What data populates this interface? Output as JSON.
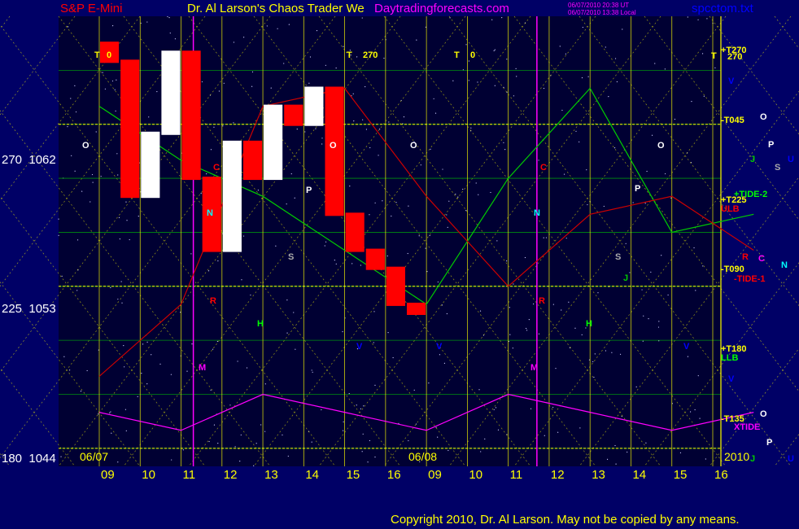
{
  "header": {
    "instrument": "S&P E-Mini",
    "title": "Dr. Al Larson's Chaos Trader We",
    "site": "Daytradingforecasts.com",
    "stamp_line1": "06/07/2010 20:38 UT",
    "stamp_line2": "06/07/2010 13:38 Local",
    "file": "spcctom.txt"
  },
  "colors": {
    "background": "#000066",
    "plot_bg": "#000033",
    "price_up": "#ffffff",
    "price_down": "#ff0000",
    "grid_yellow": "#ffff00",
    "grid_green": "#00cc00",
    "red_curve": "#cc0000",
    "green_curve": "#00cc00",
    "xtide": "#ff00ff",
    "time_marker_magenta": "#ff00ff"
  },
  "y_axis_labels": [
    {
      "angle": "270",
      "price": "1062"
    },
    {
      "angle": "225",
      "price": "1053"
    },
    {
      "angle": "180",
      "price": "1044"
    }
  ],
  "right_labels": [
    {
      "text": "+T270",
      "color": "#ffff00"
    },
    {
      "text": "T",
      "color": "#ffff00"
    },
    {
      "text": "270",
      "color": "#ffff00"
    },
    {
      "text": "-T045",
      "color": "#ffff00"
    },
    {
      "text": "+T225",
      "color": "#ffff00"
    },
    {
      "text": "+TIDE-2",
      "color": "#00ff00"
    },
    {
      "text": "ULB",
      "color": "#ff0000"
    },
    {
      "text": "-T090",
      "color": "#ffff00"
    },
    {
      "text": "-TIDE-1",
      "color": "#ff0000"
    },
    {
      "text": "+T180",
      "color": "#ffff00"
    },
    {
      "text": "LLB",
      "color": "#00ff00"
    },
    {
      "text": "-T135",
      "color": "#ffff00"
    },
    {
      "text": "XTIDE",
      "color": "#ff00ff"
    }
  ],
  "legend_glyphs": [
    {
      "text": "O",
      "color": "#ffffff"
    },
    {
      "text": "J",
      "color": "#00cc00"
    },
    {
      "text": "P",
      "color": "#ffffff"
    },
    {
      "text": "S",
      "color": "#aaaaaa"
    },
    {
      "text": "U",
      "color": "#0000ff"
    },
    {
      "text": "R",
      "color": "#ff0000"
    },
    {
      "text": "C",
      "color": "#ff00ff"
    },
    {
      "text": "N",
      "color": "#00ffff"
    },
    {
      "text": "O",
      "color": "#ffffff"
    },
    {
      "text": "P",
      "color": "#ffffff"
    },
    {
      "text": "J",
      "color": "#00cc00"
    },
    {
      "text": "U",
      "color": "#0000ff"
    }
  ],
  "chart_glyphs": [
    {
      "text": "T",
      "color": "#ffff00"
    },
    {
      "text": "0",
      "color": "#ffff00"
    },
    {
      "text": "T",
      "color": "#ffff00"
    },
    {
      "text": "270",
      "color": "#ffff00"
    },
    {
      "text": "T",
      "color": "#ffff00"
    },
    {
      "text": "0",
      "color": "#ffff00"
    },
    {
      "text": "O",
      "color": "#ffffff"
    },
    {
      "text": "O",
      "color": "#ffffff"
    },
    {
      "text": "O",
      "color": "#ffffff"
    },
    {
      "text": "O",
      "color": "#ffffff"
    },
    {
      "text": "C",
      "color": "#ff0000"
    },
    {
      "text": "C",
      "color": "#ff0000"
    },
    {
      "text": "N",
      "color": "#00ffff"
    },
    {
      "text": "N",
      "color": "#00ffff"
    },
    {
      "text": "P",
      "color": "#ffffff"
    },
    {
      "text": "P",
      "color": "#ffffff"
    },
    {
      "text": "S",
      "color": "#aaaaaa"
    },
    {
      "text": "S",
      "color": "#aaaaaa"
    },
    {
      "text": "R",
      "color": "#ff0000"
    },
    {
      "text": "R",
      "color": "#ff0000"
    },
    {
      "text": "H",
      "color": "#00ff00"
    },
    {
      "text": "H",
      "color": "#00ff00"
    },
    {
      "text": "M",
      "color": "#ff00ff"
    },
    {
      "text": "M",
      "color": "#ff00ff"
    },
    {
      "text": "V",
      "color": "#0000ff"
    },
    {
      "text": "V",
      "color": "#0000ff"
    },
    {
      "text": "V",
      "color": "#0000ff"
    },
    {
      "text": "V",
      "color": "#0000ff"
    },
    {
      "text": "V",
      "color": "#0000ff"
    },
    {
      "text": "J",
      "color": "#00cc00"
    }
  ],
  "date_labels": [
    "06/07",
    "06/08",
    "2010"
  ],
  "copyright": "Copyright 2010, Dr. Al Larson. May not be copied by any means.",
  "chart_data": {
    "type": "line",
    "title": "S&P E-Mini",
    "x_tick_labels": [
      "09",
      "10",
      "11",
      "12",
      "13",
      "14",
      "15",
      "16",
      "09",
      "10",
      "11",
      "12",
      "13",
      "14",
      "15",
      "16"
    ],
    "y_axis": {
      "labels": [
        "1062",
        "1053",
        "1044"
      ],
      "angle_labels": [
        "270",
        "225",
        "180"
      ],
      "ylim": [
        1043,
        1068
      ]
    },
    "grid": true,
    "series": [
      {
        "name": "price",
        "sessions": [
          "06/07"
        ],
        "x": [
          0,
          0.5,
          1,
          1.5,
          2,
          2.5,
          3,
          3.5,
          4,
          4.5,
          5,
          5.5,
          6,
          6.5,
          7,
          7.5,
          8
        ],
        "y": [
          1066.5,
          1065.5,
          1058,
          1061.5,
          1066,
          1059,
          1055,
          1061,
          1059,
          1063,
          1062,
          1064,
          1057,
          1055,
          1054,
          1052,
          1051.5
        ]
      },
      {
        "name": "+TIDE-2",
        "x": [
          0,
          2,
          4,
          6,
          8,
          10,
          12,
          14,
          16
        ],
        "y": [
          1063,
          1060,
          1058,
          1055,
          1052,
          1059,
          1064,
          1056,
          1057
        ]
      },
      {
        "name": "-TIDE-1",
        "x": [
          0,
          2,
          4,
          6,
          8,
          10,
          12,
          14,
          16
        ],
        "y": [
          1048,
          1052,
          1063,
          1064,
          1058,
          1053,
          1057,
          1058,
          1055
        ]
      },
      {
        "name": "XTIDE",
        "x": [
          0,
          2,
          4,
          6,
          8,
          10,
          12,
          14,
          16
        ],
        "y": [
          1046,
          1045,
          1047,
          1046,
          1045,
          1047,
          1046,
          1045,
          1046
        ]
      }
    ]
  }
}
